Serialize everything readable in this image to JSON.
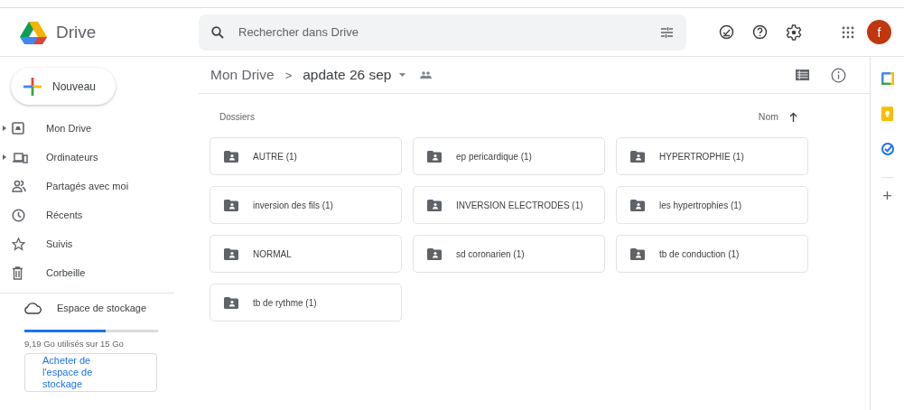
{
  "header": {
    "app_name": "Drive",
    "search": {
      "placeholder": "Rechercher dans Drive"
    },
    "avatar": "f"
  },
  "sidebar": {
    "new_button": "Nouveau",
    "items": [
      {
        "label": "Mon Drive",
        "kind": "drive",
        "expandable": true
      },
      {
        "label": "Ordinateurs",
        "kind": "computers",
        "expandable": true
      },
      {
        "label": "Partagés avec moi",
        "kind": "shared",
        "expandable": false
      },
      {
        "label": "Récents",
        "kind": "recent",
        "expandable": false
      },
      {
        "label": "Suivis",
        "kind": "starred",
        "expandable": false
      },
      {
        "label": "Corbeille",
        "kind": "trash",
        "expandable": false
      }
    ],
    "storage": {
      "label": "Espace de stockage",
      "level": 0.61,
      "usage": "9,19 Go utilisés sur 15 Go",
      "buy_button": "Acheter de l'espace de stockage"
    }
  },
  "breadcrumb": {
    "root": "Mon Drive",
    "separator": ">",
    "current": "apdate 26 sep"
  },
  "folders_section": {
    "title": "Dossiers",
    "sort_label": "Nom",
    "sort_ascending": true,
    "folders": [
      {
        "name": "AUTRE (1)"
      },
      {
        "name": "ep pericardique (1)"
      },
      {
        "name": "HYPERTROPHIE (1)"
      },
      {
        "name": "inversion des fils (1)"
      },
      {
        "name": "INVERSION ELECTRODES (1)"
      },
      {
        "name": "les hypertrophies (1)"
      },
      {
        "name": "NORMAL"
      },
      {
        "name": "sd coronarien (1)"
      },
      {
        "name": "tb de conduction (1)"
      },
      {
        "name": "tb de rythme (1)"
      }
    ]
  },
  "side_panel": {
    "add_button": "+"
  }
}
